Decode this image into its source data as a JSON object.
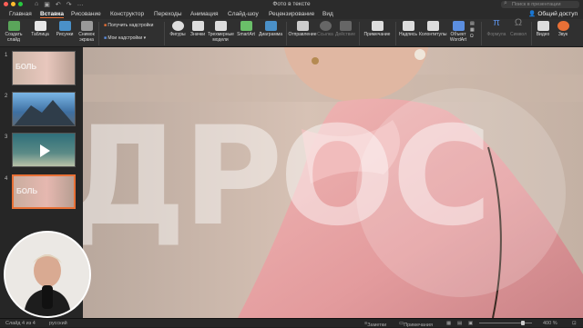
{
  "window": {
    "title": "Фото в тексте",
    "search_placeholder": "Поиск в презентации"
  },
  "tabs": [
    {
      "label": "Главная",
      "active": false
    },
    {
      "label": "Вставка",
      "active": true
    },
    {
      "label": "Рисование",
      "active": false
    },
    {
      "label": "Конструктор",
      "active": false
    },
    {
      "label": "Переходы",
      "active": false
    },
    {
      "label": "Анимация",
      "active": false
    },
    {
      "label": "Слайд-шоу",
      "active": false
    },
    {
      "label": "Рецензирование",
      "active": false
    },
    {
      "label": "Вид",
      "active": false
    }
  ],
  "share_label": "Общий доступ",
  "ribbon": {
    "new_slide": "Создать слайд",
    "table": "Таблица",
    "pictures": "Рисунки",
    "screenshot": "Снимок экрана",
    "get_addins": "Получить надстройки",
    "my_addins": "Мои надстройки",
    "shapes": "Фигуры",
    "icons": "Значки",
    "models_3d": "Трехмерные модели",
    "smartart": "SmartArt",
    "chart": "Диаграмма",
    "zoom": "Отправление",
    "link": "Ссылка",
    "action": "Действие",
    "comment": "Примечание",
    "textbox": "Надпись",
    "header_footer": "Колонтитулы",
    "wordart": "Объект WordArt",
    "equation": "Формула",
    "symbol": "Символ",
    "video": "Видео",
    "audio": "Звук"
  },
  "slides": [
    {
      "num": "1",
      "label": "БОЛЬ",
      "selected": false
    },
    {
      "num": "2",
      "label": "",
      "selected": false
    },
    {
      "num": "3",
      "label": "",
      "selected": false
    },
    {
      "num": "4",
      "label": "БОЛЬ",
      "selected": true
    }
  ],
  "slide_main": {
    "big_text": "ДРОС"
  },
  "status": {
    "slide_info": "Слайд 4 из 4",
    "language": "русский",
    "notes": "Заметки",
    "comments": "Примечания",
    "zoom": "400 %"
  },
  "colors": {
    "accent": "#e87036",
    "ribbon_bg": "#303030",
    "panel_bg": "#262626"
  }
}
